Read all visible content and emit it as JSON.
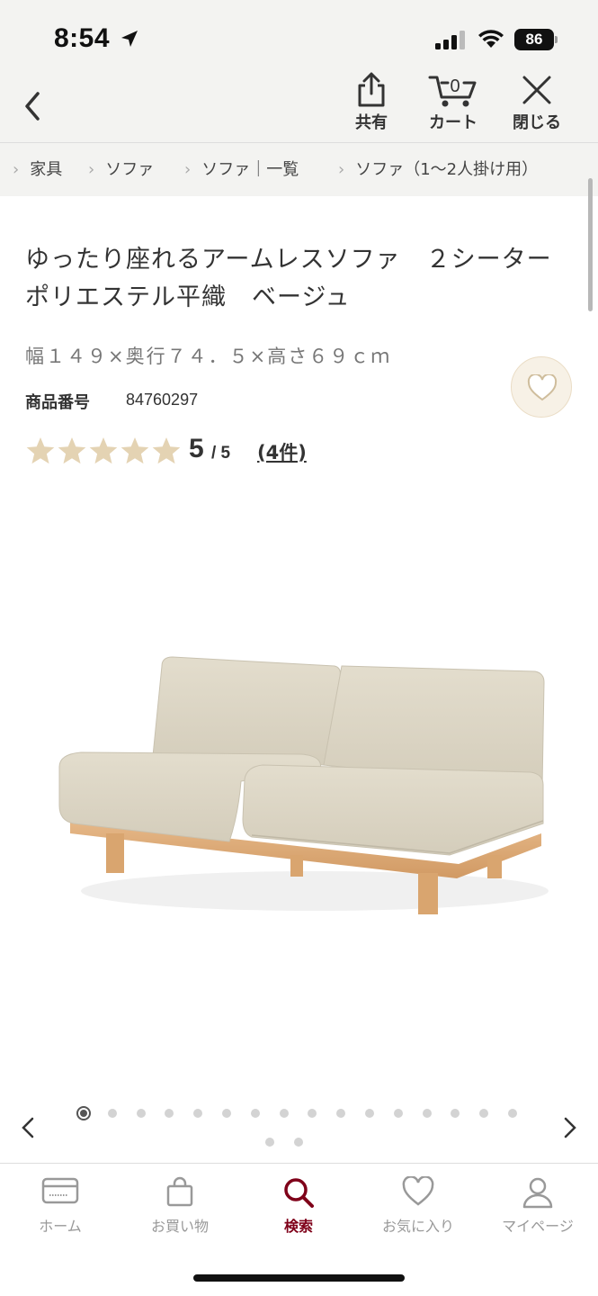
{
  "status_bar": {
    "time": "8:54",
    "battery": "86"
  },
  "header": {
    "share_label": "共有",
    "cart_count": "0",
    "cart_label": "カート",
    "close_label": "閉じる"
  },
  "breadcrumb": [
    "家具",
    "ソファ",
    "ソファ｜一覧",
    "ソファ（1〜2人掛け用）"
  ],
  "product": {
    "title": "ゆったり座れるアームレスソファ　２シーター　ポリエステル平織　ベージュ",
    "size": "幅１４９×奥行７４．５×高さ６９ｃｍ",
    "product_number_label": "商品番号",
    "product_number": "84760297",
    "rating": {
      "stars": 5,
      "score": "5",
      "out_of": "/ 5",
      "reviews": "(4件)"
    }
  },
  "gallery": {
    "total_images": 18,
    "current_index": 0
  },
  "tabbar": [
    {
      "label": "ホーム",
      "icon": "card-icon",
      "active": false
    },
    {
      "label": "お買い物",
      "icon": "shopping-bag-icon",
      "active": false
    },
    {
      "label": "検索",
      "icon": "search-icon",
      "active": true
    },
    {
      "label": "お気に入り",
      "icon": "heart-icon",
      "active": false
    },
    {
      "label": "マイページ",
      "icon": "person-icon",
      "active": false
    }
  ],
  "colors": {
    "header_bg": "#f3f3f1",
    "accent": "#7f0019",
    "star": "#e4d3b3",
    "favorite_bg": "#f7f1e6"
  }
}
